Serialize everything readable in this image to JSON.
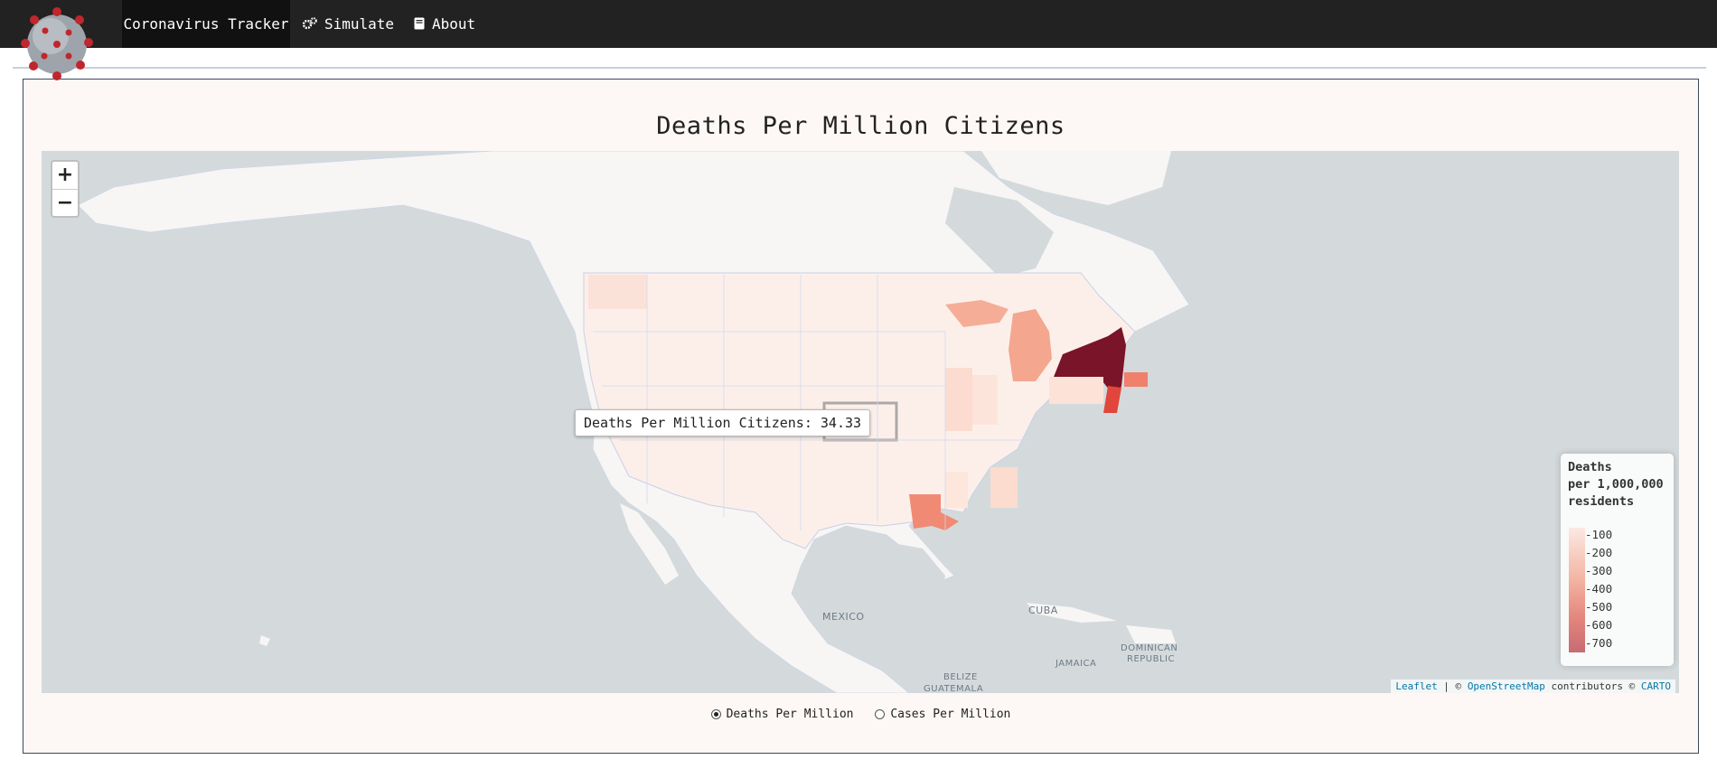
{
  "navbar": {
    "brand": "Coronavirus Tracker",
    "items": [
      {
        "label": "Simulate",
        "icon": "cogs-icon"
      },
      {
        "label": "About",
        "icon": "book-icon"
      }
    ]
  },
  "page": {
    "title": "Deaths Per Million Citizens"
  },
  "map": {
    "zoom_in": "+",
    "zoom_out": "−",
    "tooltip": "Deaths Per Million Citizens: 34.33",
    "places": [
      "MEXICO",
      "CUBA",
      "JAMAICA",
      "DOMINICAN",
      "REPUBLIC",
      "BELIZE",
      "GUATEMALA"
    ],
    "legend": {
      "title": "Deaths\nper 1,000,000\nresidents",
      "ticks": [
        "-100",
        "-200",
        "-300",
        "-400",
        "-500",
        "-600",
        "-700"
      ]
    },
    "attribution": {
      "leaflet": "Leaflet",
      "sep": " | © ",
      "osm": "OpenStreetMap",
      "contributors": " contributors © ",
      "carto": "CARTO"
    },
    "colors": {
      "water": "#d4dadc",
      "land": "#f7f6f4",
      "low": "#fdece6",
      "mid": "#f6a48e",
      "high": "#7a1428"
    }
  },
  "controls": {
    "options": [
      {
        "label": "Deaths Per Million",
        "selected": true
      },
      {
        "label": "Cases Per Million",
        "selected": false
      }
    ]
  }
}
